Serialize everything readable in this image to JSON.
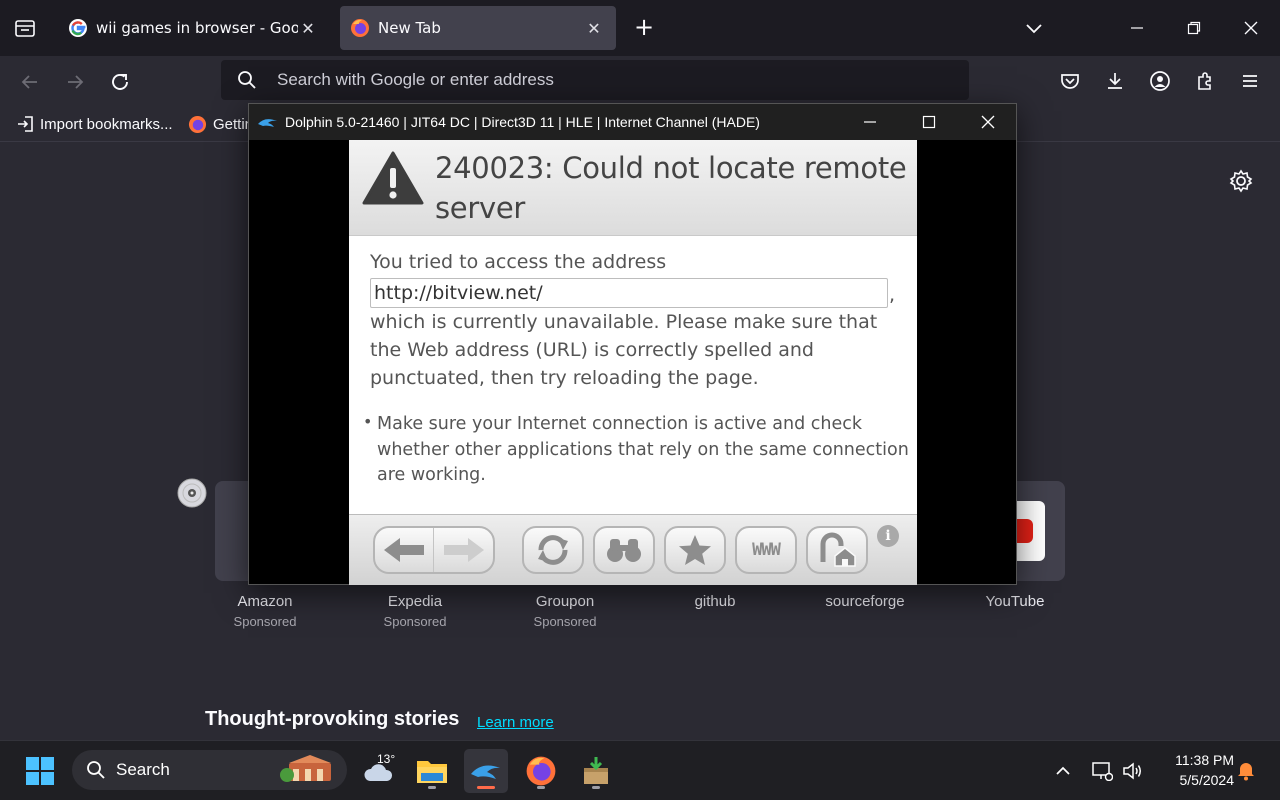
{
  "browser": {
    "tabs": [
      {
        "title": "wii games in browser - Google Search",
        "favicon": "google-icon"
      },
      {
        "title": "New Tab",
        "favicon": "firefox-icon",
        "active": true
      }
    ],
    "url_placeholder": "Search with Google or enter address",
    "bookmarks": [
      {
        "label": "Import bookmarks...",
        "icon": "import-icon"
      },
      {
        "label": "Getting Started",
        "icon": "firefox-icon"
      }
    ]
  },
  "newtab": {
    "shortcuts": [
      {
        "label": "Amazon",
        "sub": "Sponsored"
      },
      {
        "label": "Expedia",
        "sub": "Sponsored"
      },
      {
        "label": "Groupon",
        "sub": "Sponsored"
      },
      {
        "label": "github",
        "sub": ""
      },
      {
        "label": "sourceforge",
        "sub": ""
      },
      {
        "label": "YouTube",
        "sub": ""
      }
    ],
    "stories_title": "Thought-provoking stories",
    "learn_more": "Learn more"
  },
  "dolphin": {
    "title": "Dolphin 5.0-21460 | JIT64 DC | Direct3D 11 | HLE | Internet Channel (HADE)",
    "error_title": "240023: Could not locate remote server",
    "body_intro": "You tried to access the address",
    "address": "http://bitview.net/",
    "comma": ",",
    "body_rest": "which is currently unavailable. Please make sure that the Web address (URL) is correctly spelled and punctuated, then try reloading the page.",
    "bullet": "•",
    "tip": "Make sure your Internet connection is active and check whether other applications that rely on the same connection are working.",
    "toolbar_buttons": [
      "back-icon",
      "forward-icon",
      "reload-icon",
      "search-binoculars-icon",
      "favorites-star-icon",
      "www-icon",
      "home-icon"
    ],
    "www_label": "WWW",
    "info_label": "i"
  },
  "taskbar": {
    "search_label": "Search",
    "weather_temp": "13°",
    "time": "11:38 PM",
    "date": "5/5/2024"
  }
}
